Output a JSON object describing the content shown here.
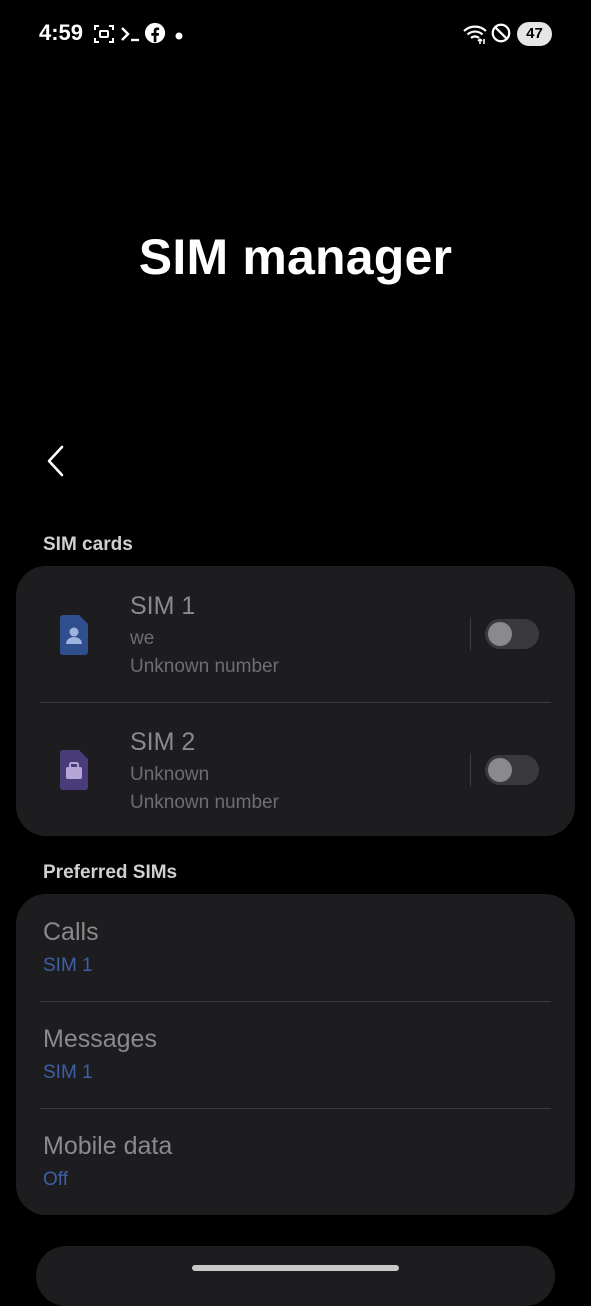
{
  "status_bar": {
    "time": "4:59",
    "battery": "47",
    "icons": [
      "screenshot-icon",
      "terminal-icon",
      "facebook-icon",
      "dot-icon",
      "wifi-icon",
      "do-not-disturb-icon"
    ]
  },
  "header": {
    "title": "SIM manager"
  },
  "sim_cards": {
    "section_label": "SIM cards",
    "items": [
      {
        "title": "SIM 1",
        "name": "we",
        "number": "Unknown number",
        "enabled": false,
        "icon_color": "#2f4f8f",
        "icon": "person-sim-icon"
      },
      {
        "title": "SIM 2",
        "name": "Unknown",
        "number": "Unknown number",
        "enabled": false,
        "icon_color": "#4a3b7a",
        "icon": "briefcase-sim-icon"
      }
    ]
  },
  "preferred_sims": {
    "section_label": "Preferred SIMs",
    "items": [
      {
        "title": "Calls",
        "value": "SIM 1"
      },
      {
        "title": "Messages",
        "value": "SIM 1"
      },
      {
        "title": "Mobile data",
        "value": "Off"
      }
    ]
  },
  "colors": {
    "accent": "#3d5fa8",
    "card": "#1d1d1f",
    "background": "#000000"
  }
}
